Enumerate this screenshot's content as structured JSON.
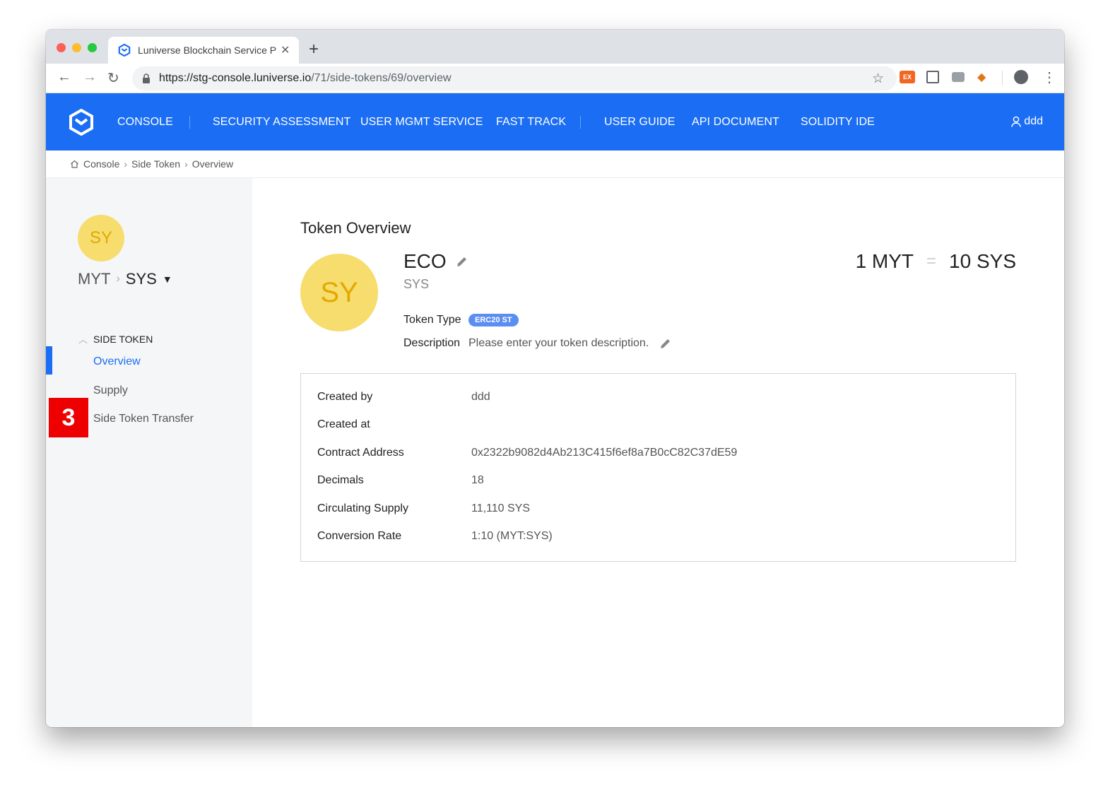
{
  "browser": {
    "tab_title": "Luniverse Blockchain Service P",
    "url_host": "https://stg-console.luniverse.io",
    "url_path": "/71/side-tokens/69/overview",
    "ext_label": "EX"
  },
  "nav": {
    "items": [
      "CONSOLE",
      "SECURITY ASSESSMENT",
      "USER MGMT SERVICE",
      "FAST TRACK",
      "USER GUIDE",
      "API DOCUMENT",
      "SOLIDITY IDE"
    ],
    "user": "ddd"
  },
  "breadcrumb": [
    "Console",
    "Side Token",
    "Overview"
  ],
  "sidebar": {
    "avatar_initials": "SY",
    "from_token": "MYT",
    "to_token": "SYS",
    "section_title": "SIDE TOKEN",
    "items": [
      "Overview",
      "Supply",
      "Side Token Transfer"
    ],
    "step_badge": "3"
  },
  "main": {
    "title": "Token Overview",
    "avatar_initials": "SY",
    "token_name": "ECO",
    "token_symbol": "SYS",
    "rate_left": "1 MYT",
    "rate_eq": "=",
    "rate_right": "10 SYS",
    "token_type_label": "Token Type",
    "token_type_value": "ERC20 ST",
    "description_label": "Description",
    "description_value": "Please enter your token description."
  },
  "details": [
    {
      "key": "Created by",
      "value": "ddd"
    },
    {
      "key": "Created at",
      "value": ""
    },
    {
      "key": "Contract Address",
      "value": "0x2322b9082d4Ab213C415f6ef8a7B0cC82C37dE59"
    },
    {
      "key": "Decimals",
      "value": "18"
    },
    {
      "key": "Circulating Supply",
      "value": "11,110 SYS"
    },
    {
      "key": "Conversion Rate",
      "value": "1:10 (MYT:SYS)"
    }
  ],
  "colors": {
    "brand_blue": "#1b6ef3",
    "avatar_yellow": "#f6dd6e",
    "step_badge_red": "#ee0000"
  }
}
